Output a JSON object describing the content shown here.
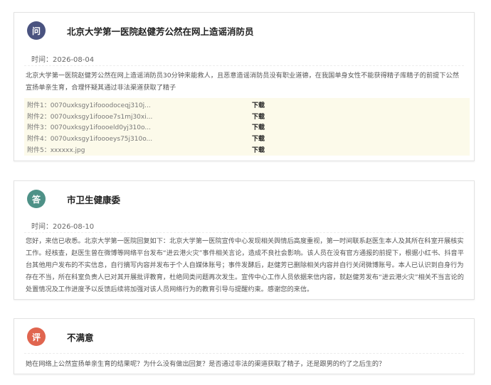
{
  "question": {
    "badge": "问",
    "badge_color": "#4a5380",
    "title": "北京大学第一医院赵健芳公然在网上造谣消防员",
    "time_label": "时间：2026-08-04",
    "content": "北京大学第一医院赵健芳公然在网上造谣消防员30分钟来能救人，且恶意造谣消防员没有职业道德，在我国单身女性不能获得精子库精子的前提下公然宣扬单亲生育，合理怀疑其通过非法渠道获取了精子",
    "attachments": [
      {
        "name": "附件1：0070uxksgy1ifooodoceqj310j...",
        "action": "下载"
      },
      {
        "name": "附件2：0070uxksgy1ifoooe7s1mj30xi...",
        "action": "下载"
      },
      {
        "name": "附件3：0070uxksgy1ifoooeld0yj310o...",
        "action": "下载"
      },
      {
        "name": "附件4：0070uxksgy1ifoooeys75j310o...",
        "action": "下载"
      },
      {
        "name": "附件5：xxxxxx.jpg",
        "action": "下载"
      }
    ]
  },
  "answer": {
    "badge": "答",
    "badge_color": "#4e9187",
    "title": "市卫生健康委",
    "time_label": "时间：2026-08-10",
    "content": "您好，来信已收悉。北京大学第一医院回复如下：北京大学第一医院宣传中心发现相关舆情后高度重视，第一时间联系赵医生本人及其所在科室开展核实工作。经核查，赵医生曾在微博等网络平台发布“进云港火灾”事件相关言论，造成不良社会影响。该人员在没有官方通报的前提下，根据小红书、抖音平台其他用户发布的不实信息，自行摘写内容并发布于个人自媒体账号；事件发酵后，赵健芳已删除相关内容并自行关闭微博账号。本人已认识到自身行为存在不当，所在科室负责人已对其开展批评教育，杜绝同类问题再次发生。宣传中心工作人员依据来信内容，就赵健芳发布“进云港火灾”相关不当言论的处置情况及工作进度予以反馈后续将加强对该人员网络行为的教育引导与提醒约束。感谢您的来信。"
  },
  "review": {
    "badge": "评",
    "badge_color": "#e0654f",
    "title": "不满意",
    "content": "她在网络上公然宣扬单亲生育的结果呢？为什么没有做出回复？是否通过非法的渠道获取了精子，还是跟男的约了之后生的？"
  }
}
